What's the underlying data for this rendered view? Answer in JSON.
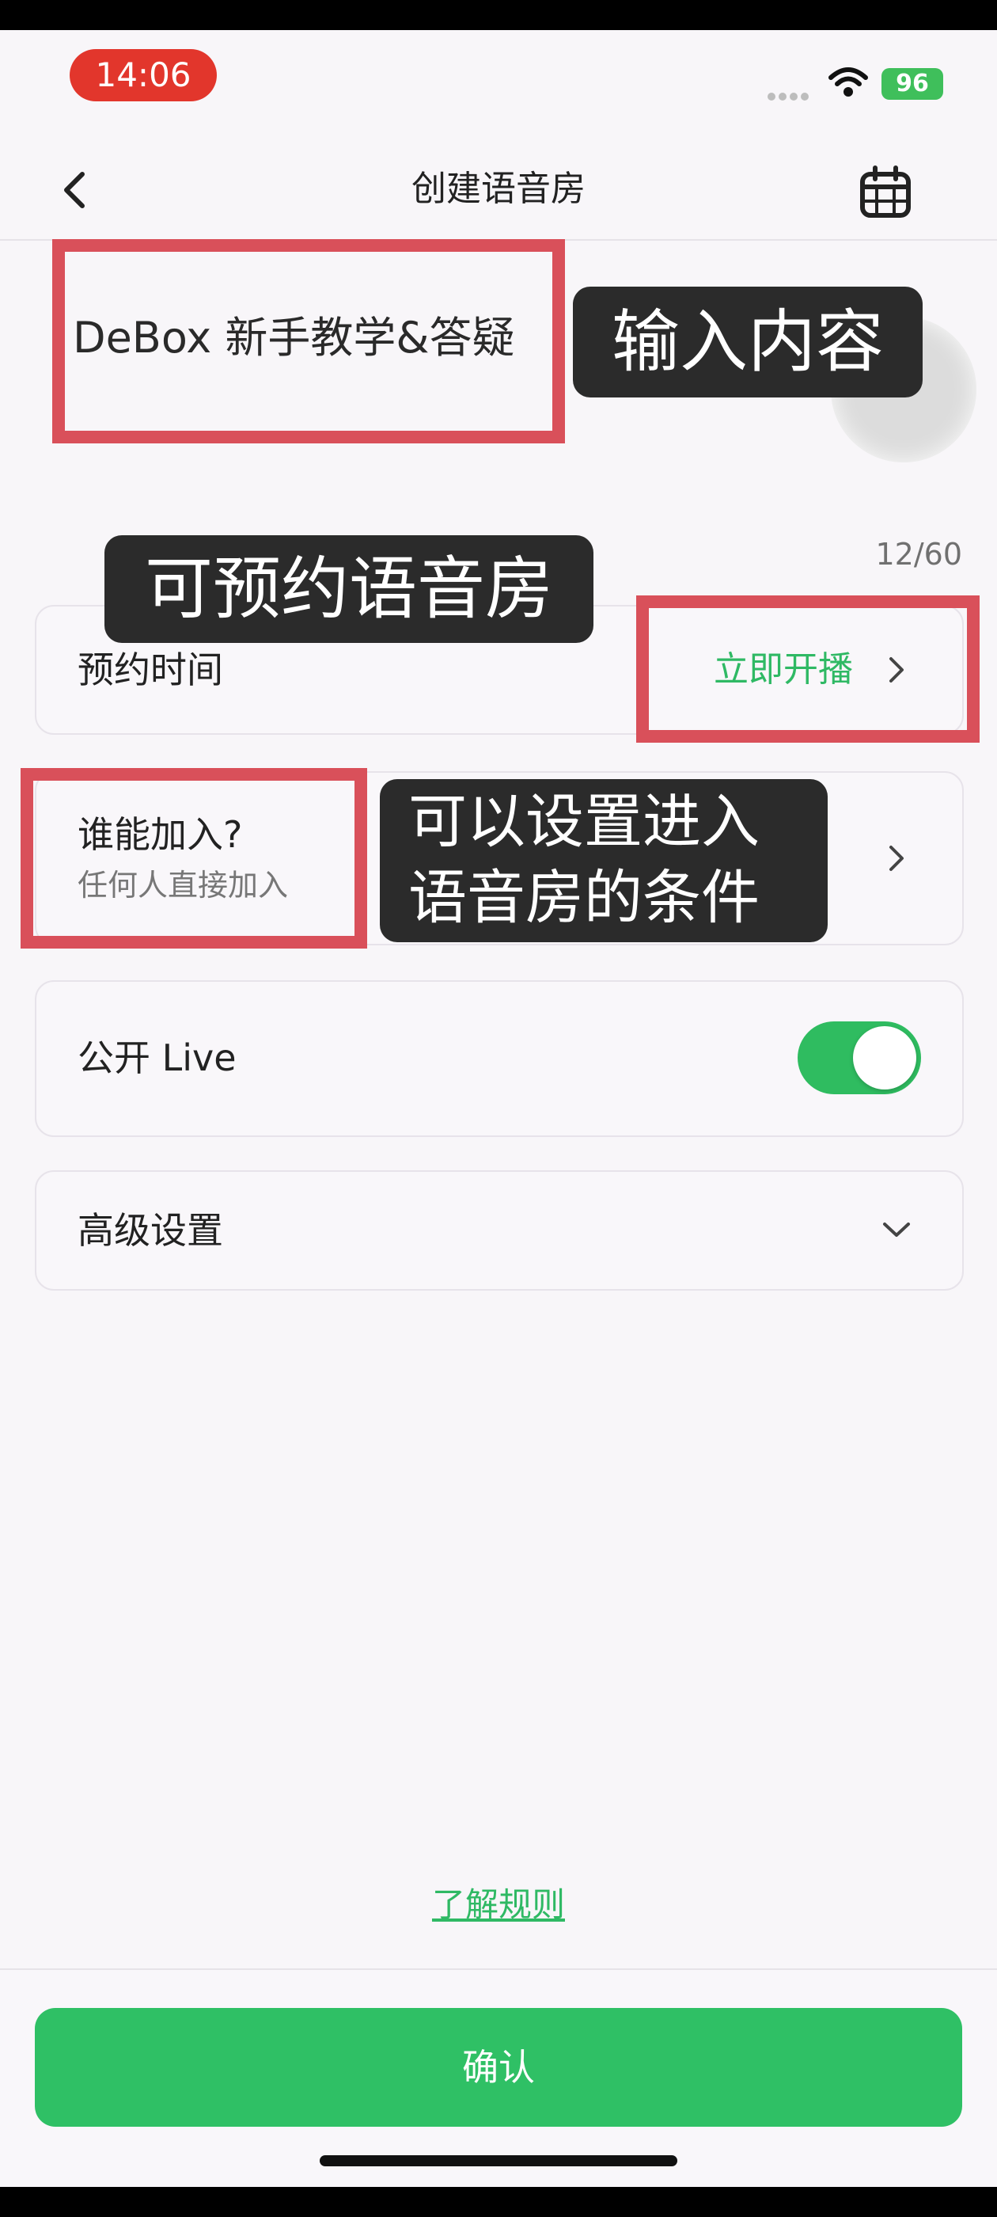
{
  "status_bar": {
    "time": "14:06",
    "battery": "96",
    "icons": [
      "signal-dots-icon",
      "wifi-icon",
      "battery-charging-icon"
    ]
  },
  "nav": {
    "title": "创建语音房",
    "back_icon": "chevron-left-icon",
    "calendar_icon": "calendar-icon"
  },
  "room_title": {
    "value": "DeBox 新手教学&答疑",
    "char_count": "12/60"
  },
  "schedule": {
    "label": "预约时间",
    "value": "立即开播"
  },
  "join": {
    "label": "谁能加入?",
    "value": "任何人直接加入"
  },
  "live": {
    "label": "公开 Live",
    "enabled": true
  },
  "advanced": {
    "label": "高级设置"
  },
  "footer": {
    "rules_link": "了解规则",
    "confirm": "确认"
  },
  "annotations": {
    "input_tag": "输入内容",
    "reserve_tag": "可预约语音房",
    "condition_line1": "可以设置进入",
    "condition_line2": "语音房的条件"
  },
  "colors": {
    "accent_green": "#2fc065",
    "highlight_red": "#d9505a",
    "time_pill_red": "#e2362c"
  }
}
